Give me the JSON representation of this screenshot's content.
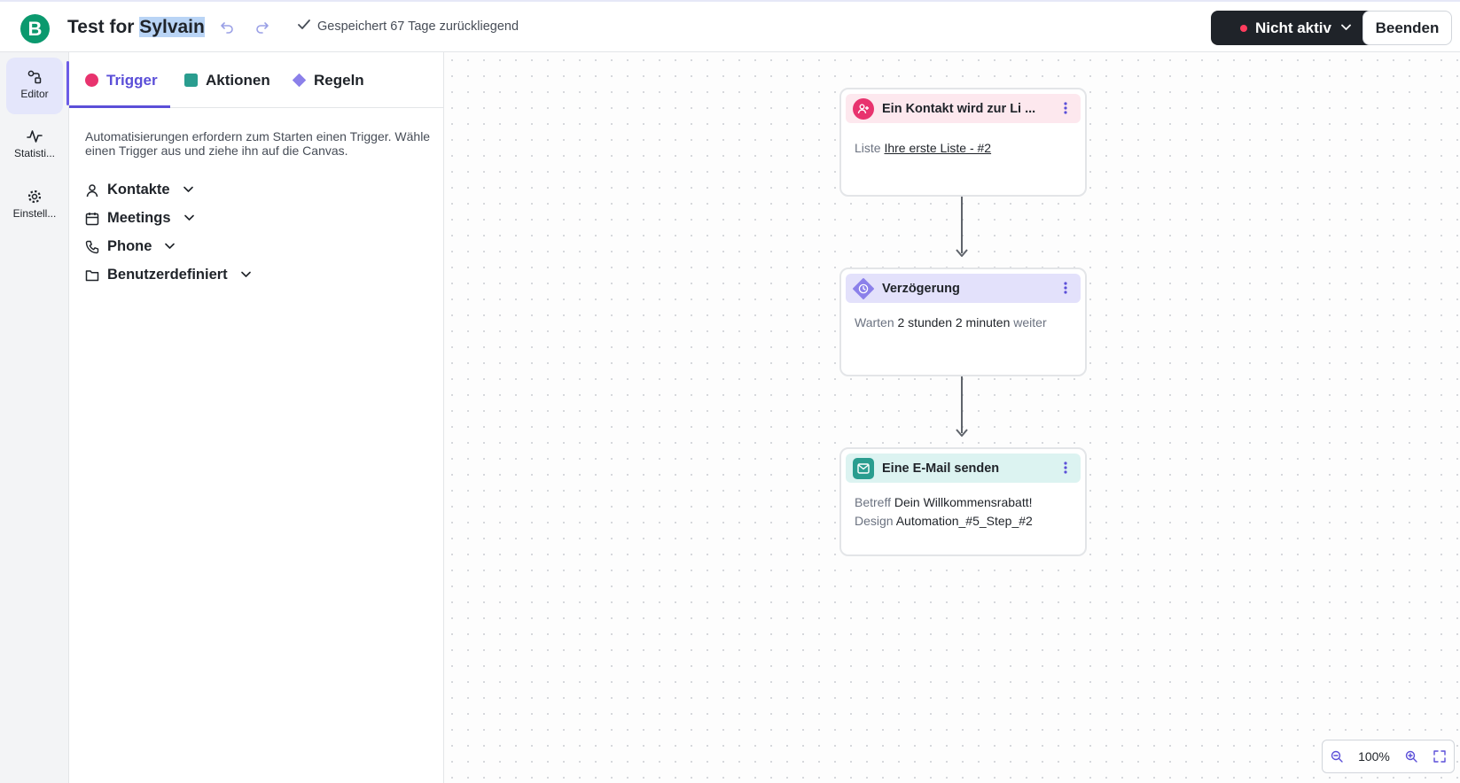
{
  "app": {
    "logo_letter": "B",
    "brand_color": "#0b996e",
    "accent_color": "#5b4fd8"
  },
  "header": {
    "title_prefix": "Test for ",
    "title_highlight": "Sylvain",
    "undo_icon": "undo-icon",
    "redo_icon": "redo-icon",
    "saved_status": "Gespeichert 67 Tage zurückliegend",
    "status_button": "Nicht aktiv",
    "status_dot_color": "#ff3d5e",
    "end_button": "Beenden"
  },
  "rail": {
    "items": [
      {
        "label": "Editor",
        "icon": "editor-icon",
        "active": true
      },
      {
        "label": "Statisti...",
        "icon": "activity-icon",
        "active": false
      },
      {
        "label": "Einstell...",
        "icon": "gear-icon",
        "active": false
      }
    ]
  },
  "panel": {
    "tabs": [
      {
        "label": "Trigger",
        "color": "#e8336e",
        "active": true
      },
      {
        "label": "Aktionen",
        "color": "#2a9d8f",
        "active": false
      },
      {
        "label": "Regeln",
        "color": "#8b80ea",
        "active": false
      }
    ],
    "description": "Automatisierungen erfordern zum Starten einen Trigger. Wähle einen Trigger aus und ziehe ihn auf die Canvas.",
    "categories": [
      {
        "label": "Kontakte",
        "icon": "user-icon"
      },
      {
        "label": "Meetings",
        "icon": "calendar-icon"
      },
      {
        "label": "Phone",
        "icon": "phone-icon"
      },
      {
        "label": "Benutzerdefiniert",
        "icon": "folder-icon"
      }
    ]
  },
  "canvas": {
    "nodes": [
      {
        "title": "Ein Kontakt wird zur Li ...",
        "icon": "user-add-icon",
        "head_color": "#fde8ee",
        "icon_color": "#e8336e",
        "lines": [
          {
            "label": "Liste ",
            "value": "Ihre erste Liste - #2"
          }
        ]
      },
      {
        "title": "Verzögerung",
        "icon": "clock-icon",
        "head_color": "#e3e1fb",
        "icon_color": "#8b80ea",
        "lines": [
          {
            "label": "Warten ",
            "value": "2 stunden 2 minuten",
            "suffix": " weiter"
          }
        ]
      },
      {
        "title": "Eine E-Mail senden",
        "icon": "mail-icon",
        "head_color": "#dcf3f1",
        "icon_color": "#2a9d8f",
        "lines": [
          {
            "label": "Betreff ",
            "value": "Dein Willkommensrabatt!"
          },
          {
            "label": "Design ",
            "value": "Automation_#5_Step_#2"
          }
        ]
      }
    ],
    "zoom": {
      "level": "100%"
    }
  }
}
